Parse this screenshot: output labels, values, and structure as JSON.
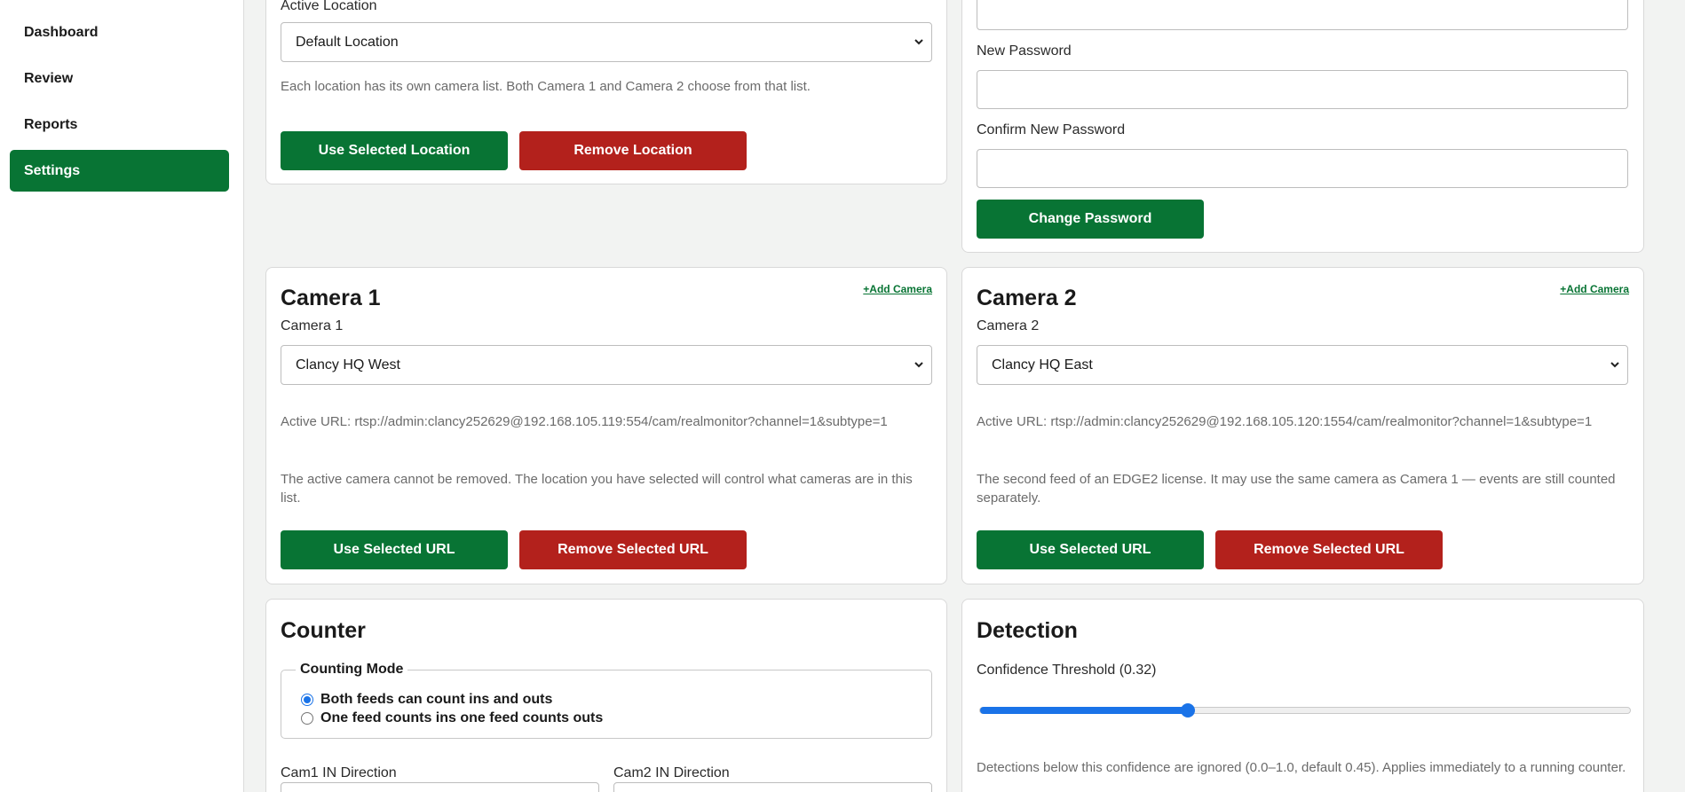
{
  "sidebar": {
    "items": [
      {
        "label": "Dashboard"
      },
      {
        "label": "Review"
      },
      {
        "label": "Reports"
      },
      {
        "label": "Settings"
      }
    ]
  },
  "location": {
    "label": "Active Location",
    "selected": "Default Location",
    "help": "Each location has its own camera list. Both Camera 1 and Camera 2 choose from that list.",
    "use_label": "Use Selected Location",
    "remove_label": "Remove Location"
  },
  "password": {
    "new_label": "New Password",
    "new_value": "",
    "confirm_label": "Confirm New Password",
    "confirm_value": "",
    "change_label": "Change Password"
  },
  "camera1": {
    "title": "Camera 1",
    "add_label": "+Add Camera",
    "select_label": "Camera 1",
    "selected": "Clancy HQ West",
    "active_url": "Active URL: rtsp://admin:clancy252629@192.168.105.119:554/cam/realmonitor?channel=1&subtype=1",
    "note": "The active camera cannot be removed. The location you have selected will control what cameras are in this list.",
    "use_label": "Use Selected URL",
    "remove_label": "Remove Selected URL"
  },
  "camera2": {
    "title": "Camera 2",
    "add_label": "+Add Camera",
    "select_label": "Camera 2",
    "selected": "Clancy HQ East",
    "active_url": "Active URL: rtsp://admin:clancy252629@192.168.105.120:1554/cam/realmonitor?channel=1&subtype=1",
    "note": "The second feed of an EDGE2 license. It may use the same camera as Camera 1 — events are still counted separately.",
    "use_label": "Use Selected URL",
    "remove_label": "Remove Selected URL"
  },
  "counter": {
    "title": "Counter",
    "mode_legend": "Counting Mode",
    "options": [
      {
        "label": "Both feeds can count ins and outs",
        "checked": true
      },
      {
        "label": "One feed counts ins one feed counts outs",
        "checked": false
      }
    ],
    "cam1_dir_label": "Cam1 IN Direction",
    "cam2_dir_label": "Cam2 IN Direction"
  },
  "detection": {
    "title": "Detection",
    "threshold_label": "Confidence Threshold (0.32)",
    "threshold_value": 0.32,
    "slider_min": 0.0,
    "slider_max": 1.0,
    "help": "Detections below this confidence are ignored (0.0–1.0, default 0.45). Applies immediately to a running counter."
  },
  "colors": {
    "accent_green": "#087434",
    "danger_red": "#b3211c",
    "slider_blue": "#1a73e8"
  }
}
